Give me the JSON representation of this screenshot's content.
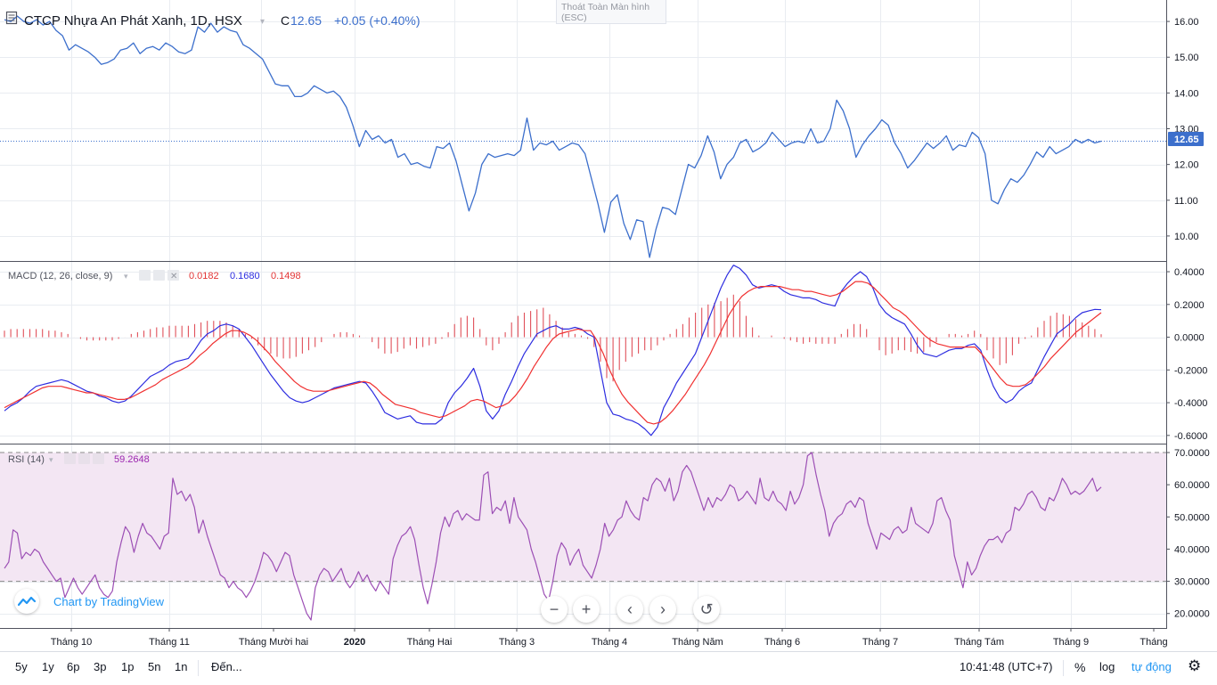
{
  "header": {
    "symbol_name": "CTCP Nhựa An Phát Xanh, 1D, HSX",
    "close_prefix": "C",
    "close_value": "12.65",
    "change": "+0.05 (+0.40%)"
  },
  "fullscreen_tip": {
    "line1": "Thoát Toàn Màn hình",
    "line2": "(ESC)"
  },
  "price_axis": {
    "ticks": [
      "16.00",
      "15.00",
      "14.00",
      "13.00",
      "12.00",
      "11.00",
      "10.00"
    ],
    "current_label": "12.65"
  },
  "macd": {
    "title": "MACD (12, 26, close, 9)",
    "hist_value": "0.0182",
    "macd_value": "0.1680",
    "signal_value": "0.1498",
    "axis_ticks": [
      "0.4000",
      "0.2000",
      "0.0000",
      "-0.2000",
      "-0.4000",
      "-0.6000"
    ]
  },
  "rsi": {
    "title": "RSI (14)",
    "value": "59.2648",
    "axis_ticks": [
      "70.0000",
      "60.0000",
      "50.0000",
      "40.0000",
      "30.0000",
      "20.0000"
    ]
  },
  "time_axis": {
    "labels": [
      "Tháng 10",
      "Tháng 11",
      "Tháng Mười hai",
      "2020",
      "Tháng Hai",
      "Tháng 3",
      "Tháng 4",
      "Tháng Năm",
      "Tháng 6",
      "Tháng 7",
      "Tháng Tám",
      "Tháng 9",
      "Tháng"
    ]
  },
  "watermark": {
    "label": "Chart by TradingView"
  },
  "bottom_bar": {
    "ranges": [
      "5y",
      "1y",
      "6p",
      "3p",
      "1p",
      "5n",
      "1n"
    ],
    "goto": "Đến...",
    "clock": "10:41:48 (UTC+7)",
    "percent": "%",
    "log": "log",
    "auto": "tự động"
  },
  "colors": {
    "price_line": "#3c6fcc",
    "macd_line": "#2d2de0",
    "signal_line": "#f03030",
    "histogram": "#e0505a",
    "rsi_line": "#9c4fb5",
    "rsi_band": "#f3e6f3",
    "accent": "#2196f3"
  },
  "chart_data": [
    {
      "type": "line",
      "title": "CTCP Nhựa An Phát Xanh, 1D, HSX",
      "ylim": [
        9.3,
        16.6
      ],
      "series": [
        {
          "values": [
            16.05,
            16.0,
            16.15,
            16.0,
            15.95,
            16.05,
            15.9,
            16.0,
            15.75,
            15.6,
            15.2,
            15.35,
            15.25,
            15.15,
            15.0,
            14.8,
            14.85,
            14.95,
            15.2,
            15.25,
            15.4,
            15.1,
            15.25,
            15.3,
            15.2,
            15.4,
            15.3,
            15.15,
            15.1,
            15.2,
            15.85,
            15.7,
            15.95,
            15.7,
            15.85,
            15.75,
            15.7,
            15.35,
            15.25,
            15.1,
            14.95,
            14.6,
            14.25,
            14.2,
            14.2,
            13.9,
            13.9,
            14.0,
            14.2,
            14.1,
            14.0,
            14.05,
            13.9,
            13.6,
            13.1,
            12.5,
            12.95,
            12.7,
            12.8,
            12.6,
            12.7,
            12.2,
            12.3,
            12.0,
            12.05,
            11.95,
            11.9,
            12.5,
            12.45,
            12.6,
            12.1,
            11.4,
            10.7,
            11.2,
            12.0,
            12.3,
            12.2,
            12.25,
            12.3,
            12.25,
            12.4,
            13.3,
            12.4,
            12.6,
            12.55,
            12.65,
            12.4,
            12.5,
            12.6,
            12.55,
            12.3,
            11.6,
            10.9,
            10.1,
            10.95,
            11.15,
            10.35,
            9.9,
            10.45,
            10.4,
            9.4,
            10.2,
            10.8,
            10.75,
            10.6,
            11.3,
            12.0,
            11.9,
            12.25,
            12.8,
            12.35,
            11.6,
            12.0,
            12.2,
            12.6,
            12.7,
            12.35,
            12.45,
            12.6,
            12.9,
            12.7,
            12.5,
            12.6,
            12.65,
            12.6,
            13.0,
            12.6,
            12.65,
            13.0,
            13.8,
            13.5,
            13.0,
            12.2,
            12.55,
            12.8,
            13.0,
            13.25,
            13.1,
            12.6,
            12.3,
            11.9,
            12.1,
            12.35,
            12.6,
            12.45,
            12.6,
            12.8,
            12.4,
            12.55,
            12.5,
            12.9,
            12.75,
            12.3,
            11.0,
            10.9,
            11.3,
            11.6,
            11.5,
            11.7,
            12.0,
            12.35,
            12.2,
            12.5,
            12.3,
            12.4,
            12.5,
            12.7,
            12.6,
            12.7,
            12.6,
            12.65
          ]
        }
      ]
    },
    {
      "type": "bar",
      "title": "MACD (12, 26, close, 9)",
      "ylim": [
        -0.65,
        0.46
      ],
      "series": [
        {
          "values": [
            -0.45,
            -0.42,
            -0.4,
            -0.37,
            -0.33,
            -0.3,
            -0.29,
            -0.28,
            -0.27,
            -0.26,
            -0.27,
            -0.29,
            -0.31,
            -0.33,
            -0.34,
            -0.36,
            -0.37,
            -0.39,
            -0.4,
            -0.39,
            -0.36,
            -0.32,
            -0.28,
            -0.24,
            -0.22,
            -0.2,
            -0.17,
            -0.15,
            -0.14,
            -0.13,
            -0.08,
            -0.02,
            0.02,
            0.04,
            0.07,
            0.08,
            0.07,
            0.05,
            0.0,
            -0.05,
            -0.11,
            -0.17,
            -0.23,
            -0.28,
            -0.33,
            -0.37,
            -0.39,
            -0.4,
            -0.39,
            -0.37,
            -0.35,
            -0.33,
            -0.31,
            -0.3,
            -0.29,
            -0.28,
            -0.27,
            -0.28,
            -0.33,
            -0.39,
            -0.46,
            -0.48,
            -0.5,
            -0.49,
            -0.48,
            -0.52,
            -0.53,
            -0.53,
            -0.53,
            -0.5,
            -0.4,
            -0.34,
            -0.3,
            -0.25,
            -0.19,
            -0.3,
            -0.45,
            -0.5,
            -0.45,
            -0.35,
            -0.27,
            -0.18,
            -0.1,
            -0.04,
            0.02,
            0.04,
            0.06,
            0.07,
            0.05,
            0.05,
            0.06,
            0.05,
            0.02,
            0.0,
            -0.2,
            -0.4,
            -0.47,
            -0.48,
            -0.5,
            -0.51,
            -0.53,
            -0.56,
            -0.6,
            -0.55,
            -0.43,
            -0.36,
            -0.28,
            -0.22,
            -0.16,
            -0.1,
            0.0,
            0.1,
            0.2,
            0.3,
            0.38,
            0.44,
            0.42,
            0.38,
            0.32,
            0.3,
            0.31,
            0.32,
            0.31,
            0.28,
            0.26,
            0.25,
            0.24,
            0.24,
            0.23,
            0.21,
            0.2,
            0.19,
            0.28,
            0.33,
            0.37,
            0.4,
            0.37,
            0.3,
            0.2,
            0.15,
            0.12,
            0.1,
            0.08,
            0.02,
            -0.05,
            -0.1,
            -0.11,
            -0.12,
            -0.1,
            -0.08,
            -0.07,
            -0.07,
            -0.05,
            -0.04,
            -0.08,
            -0.2,
            -0.3,
            -0.37,
            -0.4,
            -0.38,
            -0.33,
            -0.3,
            -0.28,
            -0.2,
            -0.12,
            -0.05,
            0.02,
            0.05,
            0.08,
            0.12,
            0.15,
            0.16,
            0.17,
            0.168
          ]
        },
        {
          "values": [
            -0.43,
            -0.41,
            -0.39,
            -0.37,
            -0.35,
            -0.33,
            -0.31,
            -0.3,
            -0.3,
            -0.3,
            -0.31,
            -0.32,
            -0.33,
            -0.34,
            -0.34,
            -0.35,
            -0.36,
            -0.37,
            -0.38,
            -0.38,
            -0.37,
            -0.35,
            -0.33,
            -0.31,
            -0.29,
            -0.26,
            -0.24,
            -0.22,
            -0.2,
            -0.18,
            -0.15,
            -0.11,
            -0.08,
            -0.04,
            -0.01,
            0.02,
            0.04,
            0.04,
            0.03,
            0.01,
            -0.02,
            -0.06,
            -0.1,
            -0.15,
            -0.19,
            -0.23,
            -0.27,
            -0.3,
            -0.32,
            -0.33,
            -0.33,
            -0.33,
            -0.32,
            -0.31,
            -0.3,
            -0.29,
            -0.28,
            -0.27,
            -0.28,
            -0.31,
            -0.35,
            -0.38,
            -0.41,
            -0.42,
            -0.43,
            -0.44,
            -0.46,
            -0.47,
            -0.48,
            -0.49,
            -0.48,
            -0.46,
            -0.44,
            -0.42,
            -0.39,
            -0.38,
            -0.39,
            -0.41,
            -0.43,
            -0.42,
            -0.4,
            -0.36,
            -0.31,
            -0.25,
            -0.18,
            -0.12,
            -0.06,
            -0.01,
            0.02,
            0.03,
            0.04,
            0.05,
            0.04,
            0.04,
            -0.02,
            -0.1,
            -0.2,
            -0.28,
            -0.35,
            -0.4,
            -0.44,
            -0.48,
            -0.52,
            -0.53,
            -0.52,
            -0.49,
            -0.45,
            -0.4,
            -0.35,
            -0.29,
            -0.23,
            -0.17,
            -0.1,
            -0.02,
            0.06,
            0.14,
            0.2,
            0.25,
            0.28,
            0.3,
            0.31,
            0.31,
            0.31,
            0.31,
            0.3,
            0.29,
            0.29,
            0.28,
            0.28,
            0.27,
            0.26,
            0.25,
            0.26,
            0.28,
            0.31,
            0.34,
            0.34,
            0.33,
            0.3,
            0.26,
            0.22,
            0.18,
            0.16,
            0.13,
            0.09,
            0.05,
            0.01,
            -0.02,
            -0.04,
            -0.05,
            -0.06,
            -0.06,
            -0.06,
            -0.06,
            -0.06,
            -0.1,
            -0.15,
            -0.2,
            -0.25,
            -0.29,
            -0.3,
            -0.3,
            -0.29,
            -0.26,
            -0.22,
            -0.18,
            -0.13,
            -0.09,
            -0.05,
            -0.01,
            0.03,
            0.06,
            0.09,
            0.12,
            0.1498
          ]
        },
        {
          "values": [
            0.04,
            0.05,
            0.05,
            0.05,
            0.05,
            0.05,
            0.05,
            0.04,
            0.04,
            0.03,
            0.02,
            0.0,
            -0.01,
            -0.02,
            -0.02,
            -0.02,
            -0.02,
            -0.02,
            -0.01,
            0.0,
            0.02,
            0.03,
            0.04,
            0.05,
            0.06,
            0.06,
            0.07,
            0.07,
            0.07,
            0.07,
            0.08,
            0.09,
            0.1,
            0.1,
            0.1,
            0.09,
            0.07,
            0.05,
            0.02,
            -0.01,
            -0.05,
            -0.08,
            -0.1,
            -0.12,
            -0.13,
            -0.13,
            -0.12,
            -0.1,
            -0.08,
            -0.06,
            -0.03,
            0.0,
            0.02,
            0.03,
            0.03,
            0.02,
            0.01,
            0.0,
            -0.03,
            -0.07,
            -0.1,
            -0.1,
            -0.09,
            -0.07,
            -0.05,
            -0.07,
            -0.06,
            -0.05,
            -0.04,
            -0.01,
            0.03,
            0.08,
            0.12,
            0.13,
            0.12,
            0.05,
            -0.05,
            -0.08,
            -0.04,
            0.03,
            0.09,
            0.13,
            0.15,
            0.16,
            0.17,
            0.18,
            0.14,
            0.1,
            0.06,
            0.03,
            0.02,
            0.01,
            -0.01,
            -0.06,
            -0.15,
            -0.25,
            -0.27,
            -0.2,
            -0.15,
            -0.12,
            -0.1,
            -0.08,
            -0.08,
            -0.05,
            -0.02,
            0.02,
            0.05,
            0.08,
            0.12,
            0.15,
            0.18,
            0.2,
            0.21,
            0.22,
            0.24,
            0.26,
            0.22,
            0.13,
            0.06,
            0.01,
            0.0,
            0.01,
            0.0,
            -0.01,
            -0.02,
            -0.03,
            -0.04,
            -0.03,
            -0.04,
            -0.04,
            -0.04,
            -0.04,
            0.02,
            0.05,
            0.08,
            0.08,
            0.05,
            0.0,
            -0.08,
            -0.11,
            -0.1,
            -0.08,
            -0.08,
            -0.09,
            -0.1,
            -0.09,
            -0.06,
            -0.03,
            0.0,
            0.02,
            0.02,
            0.01,
            0.02,
            0.04,
            0.02,
            -0.08,
            -0.13,
            -0.17,
            -0.16,
            -0.11,
            -0.04,
            -0.01,
            0.01,
            0.06,
            0.1,
            0.13,
            0.15,
            0.14,
            0.13,
            0.11,
            0.09,
            0.07,
            0.05,
            0.0182
          ]
        }
      ]
    },
    {
      "type": "line",
      "title": "RSI (14)",
      "ylim": [
        15.5,
        72.5
      ],
      "band": [
        30,
        70
      ],
      "series": [
        {
          "values": [
            34,
            36,
            46,
            45,
            37,
            39,
            38,
            40,
            39,
            36,
            34,
            32,
            30,
            31,
            25,
            28,
            31,
            28,
            26,
            28,
            30,
            32,
            28,
            26,
            25,
            27,
            36,
            42,
            47,
            45,
            39,
            44,
            48,
            45,
            44,
            42,
            40,
            44,
            45,
            62,
            57,
            58,
            55,
            57,
            53,
            45,
            49,
            44,
            40,
            36,
            32,
            31,
            28,
            30,
            28,
            27,
            25,
            27,
            30,
            34,
            39,
            38,
            36,
            33,
            36,
            39,
            38,
            32,
            28,
            24,
            20,
            18,
            28,
            32,
            34,
            33,
            30,
            32,
            34,
            30,
            28,
            30,
            33,
            30,
            32,
            29,
            27,
            30,
            28,
            26,
            37,
            41,
            44,
            45,
            47,
            43,
            35,
            28,
            23,
            29,
            36,
            45,
            50,
            47,
            51,
            52,
            49,
            51,
            50,
            49,
            49,
            63,
            64,
            51,
            53,
            52,
            55,
            48,
            56,
            50,
            48,
            46,
            40,
            36,
            31,
            26,
            24,
            30,
            38,
            42,
            40,
            35,
            38,
            40,
            35,
            33,
            31,
            35,
            40,
            48,
            44,
            46,
            49,
            50,
            55,
            52,
            50,
            49,
            56,
            55,
            60,
            62,
            61,
            58,
            62,
            55,
            58,
            64,
            66,
            64,
            60,
            56,
            52,
            56,
            53,
            56,
            55,
            57,
            60,
            59,
            55,
            56,
            58,
            56,
            54,
            62,
            56,
            55,
            58,
            55,
            54,
            52,
            58,
            54,
            56,
            60,
            69,
            70,
            63,
            57,
            52,
            44,
            48,
            50,
            51,
            54,
            55,
            53,
            56,
            55,
            48,
            44,
            40,
            45,
            44,
            43,
            46,
            47,
            45,
            46,
            53,
            48,
            47,
            46,
            45,
            48,
            55,
            56,
            52,
            49,
            38,
            33,
            28,
            36,
            32,
            34,
            38,
            41,
            43,
            43,
            44,
            42,
            45,
            46,
            53,
            52,
            54,
            57,
            58,
            56,
            53,
            52,
            56,
            55,
            58,
            62,
            60,
            57,
            58,
            57,
            58,
            60,
            62,
            58,
            59.26
          ]
        }
      ]
    }
  ]
}
